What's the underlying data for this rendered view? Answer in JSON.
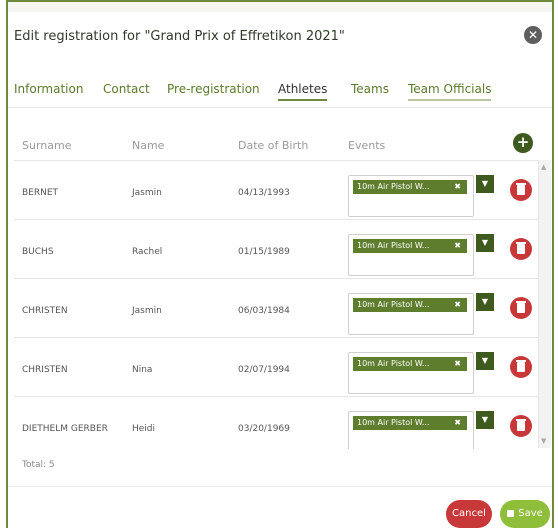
{
  "dialog": {
    "title": "Edit registration for \"Grand Prix of Effretikon 2021\"",
    "close_icon": "close-icon"
  },
  "tabs": [
    {
      "label": "Information"
    },
    {
      "label": "Contact"
    },
    {
      "label": "Pre-registration"
    },
    {
      "label": "Athletes",
      "active": true
    },
    {
      "label": "Teams"
    },
    {
      "label": "Team Officials"
    }
  ],
  "table": {
    "headers": {
      "surname": "Surname",
      "name": "Name",
      "dob": "Date of Birth",
      "events": "Events"
    },
    "add_label": "+",
    "rows": [
      {
        "surname": "BERNET",
        "name": "Jasmin",
        "dob": "04/13/1993",
        "event": "10m Air Pistol W..."
      },
      {
        "surname": "BUCHS",
        "name": "Rachel",
        "dob": "01/15/1989",
        "event": "10m Air Pistol W..."
      },
      {
        "surname": "CHRISTEN",
        "name": "Jasmin",
        "dob": "06/03/1984",
        "event": "10m Air Pistol W..."
      },
      {
        "surname": "CHRISTEN",
        "name": "Nina",
        "dob": "02/07/1994",
        "event": "10m Air Pistol W..."
      },
      {
        "surname": "DIETHELM GERBER",
        "name": "Heidi",
        "dob": "03/20/1969",
        "event": "10m Air Pistol W..."
      }
    ],
    "chip_remove": "✖",
    "dropdown_arrow": "▼"
  },
  "total": "Total: 5",
  "footer": {
    "cancel_label": "Cancel",
    "save_label": "Save"
  },
  "colors": {
    "accent": "#5e7e2e",
    "danger": "#c93838",
    "save": "#8fbe3a"
  }
}
